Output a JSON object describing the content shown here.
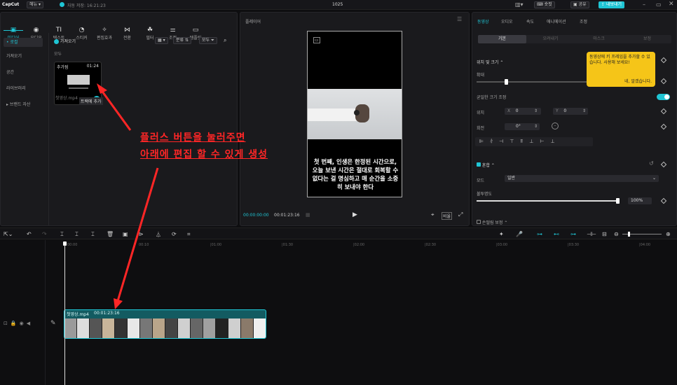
{
  "app": {
    "logo": "CapCut",
    "user_menu": "헤뉴",
    "autosave": "자동 저장: 16:21:23",
    "project_title": "1025",
    "shortcuts_label": "숏컷",
    "share_label": "공유",
    "export_label": "내보내기"
  },
  "media_tabs": [
    {
      "icon": "▣",
      "label": "미디어"
    },
    {
      "icon": "◉",
      "label": "오디오"
    },
    {
      "icon": "TI",
      "label": "텍스트"
    },
    {
      "icon": "◔",
      "label": "스티커"
    },
    {
      "icon": "✧",
      "label": "편집효과"
    },
    {
      "icon": "⋈",
      "label": "전환"
    },
    {
      "icon": "☘",
      "label": "필터"
    },
    {
      "icon": "⚌",
      "label": "조정"
    },
    {
      "icon": "▭",
      "label": "템플릿"
    }
  ],
  "sidebar": {
    "items": [
      {
        "label": "• 로컬"
      },
      {
        "label": "가져오기"
      },
      {
        "label": "공간"
      },
      {
        "label": "라이브러리"
      },
      {
        "label": "▸ 브랜드 자산"
      }
    ]
  },
  "media_panel": {
    "import_label": "가져오기",
    "sort_label": "분류",
    "all_label": "모두",
    "section_all": "모두",
    "clip": {
      "badge": "추가됨",
      "duration": "01:24",
      "filename": "첫영상.mp4",
      "tooltip": "트랙에 추가"
    }
  },
  "player": {
    "title": "플레이어",
    "caption": "첫 번째, 인생은 한정된 시간으로, 오늘 보낸 시간은 절대로 회복할 수 없다는 걸 명심하고 매 순간을 소중히 보내야 한다",
    "current_time": "00:00:00:00",
    "total_time": "00:01:23:16",
    "ratio_label": "비율"
  },
  "right_panel": {
    "tabs": [
      "동영상",
      "오디오",
      "속도",
      "애니메이션",
      "조정"
    ],
    "subtabs": [
      "기본",
      "오려내기",
      "마스크",
      "보정"
    ],
    "position_size": "위치 및 크기",
    "scale_label": "확대",
    "uniform_label": "균일한 크기 조정",
    "position_label": "위치",
    "x_label": "X",
    "x_value": "0",
    "y_label": "Y",
    "y_value": "0",
    "rotate_label": "회전",
    "rotate_value": "0°",
    "blend_label": "혼합",
    "mode_label": "모드",
    "mode_value": "일반",
    "opacity_label": "불투명도",
    "opacity_value": "100%",
    "opacity_level": 1.0,
    "stabilize_label": "손떨림 보정",
    "tooltip_text": "동영상에 키 프레임을 추가할 수 있습니다. 사용해 보세요!",
    "tooltip_ok": "네, 알겠습니다."
  },
  "timeline": {
    "ruler": [
      "00:00",
      "00:10",
      "|01:00",
      "|01:30",
      "|02:00",
      "|02:30",
      "|03:00",
      "|03:30",
      "|04:00"
    ],
    "clip_name": "첫영상.mp4",
    "clip_duration": "00:01:23:16"
  },
  "annotation": {
    "line1": "플러스 버튼을 눌러주면",
    "line2": "아래에 편집 할 수 있게 생성"
  },
  "colors": {
    "accent": "#1fc5d4",
    "annotation": "#ff2626",
    "tooltip_bg": "#f5c518"
  }
}
